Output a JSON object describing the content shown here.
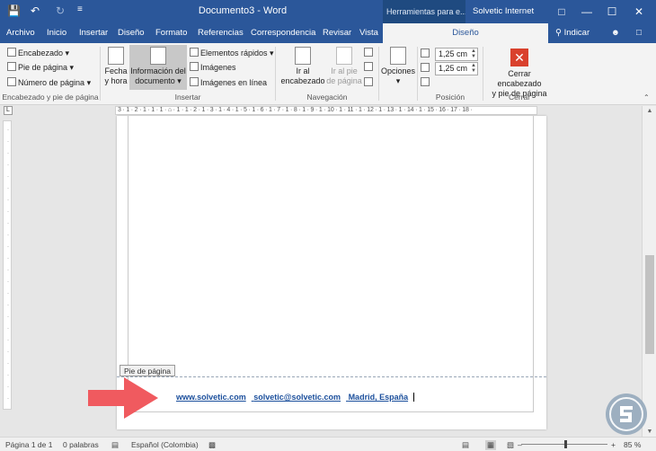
{
  "titlebar": {
    "title": "Documento3  -  Word",
    "context_tools": "Herramientas para e...",
    "account": "Solvetic Internet",
    "save_icon": "save-icon",
    "undo_icon": "undo-icon",
    "redo_icon": "redo-icon",
    "customize_icon": "customize-icon"
  },
  "tabs": {
    "items": [
      "Archivo",
      "Inicio",
      "Insertar",
      "Diseño",
      "Formato",
      "Referencias",
      "Correspondencia",
      "Revisar",
      "Vista"
    ],
    "active": "Diseño",
    "tell_me": "Indicar"
  },
  "ribbon": {
    "groups": {
      "header_footer": {
        "label": "Encabezado y pie de página",
        "encabezado": "Encabezado",
        "pie": "Pie de página",
        "numero": "Número de página"
      },
      "insert": {
        "label": "Insertar",
        "fecha_1": "Fecha",
        "fecha_2": "y hora",
        "info_1": "Información del",
        "info_2": "documento",
        "elementos": "Elementos rápidos",
        "imagenes": "Imágenes",
        "imagenes_linea": "Imágenes en línea"
      },
      "navigation": {
        "label": "Navegación",
        "ir_enc_1": "Ir al",
        "ir_enc_2": "encabezado",
        "ir_pie_1": "Ir al pie",
        "ir_pie_2": "de página"
      },
      "options": {
        "label": "Opciones"
      },
      "position": {
        "label": "Posición",
        "header_top": "1,25 cm",
        "footer_bottom": "1,25 cm"
      },
      "close": {
        "label": "Cerrar",
        "btn_1": "Cerrar encabezado",
        "btn_2": "y pie de página"
      }
    }
  },
  "ruler": {
    "scale": "3 · 1 · 2 · 1 · 1 · 1 · ⌂ · 1 · 1 · 2 · 1 · 3 · 1 · 4 · 1 · 5 · 1 · 6 · 1 · 7 · 1 · 8 · 1 · 9 · 1 · 10 · 1 · 11 · 1 · 12 · 1 · 13 · 1 · 14 · 1 · 15 · 16 · 17 · 18 ·"
  },
  "document": {
    "footer_tag": "Pie de página",
    "footer_parts": [
      "www.solvetic.com",
      "solvetic@solvetic.com",
      "Madrid, España"
    ]
  },
  "status": {
    "page": "Página 1 de 1",
    "words": "0 palabras",
    "language": "Español (Colombia)",
    "zoom": "85 %"
  }
}
